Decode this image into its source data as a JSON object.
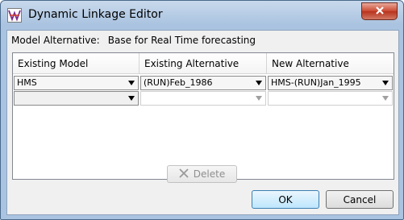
{
  "window": {
    "title": "Dynamic Linkage Editor",
    "icon": "app-logo-icon",
    "close_icon": "close-icon"
  },
  "model_alternative": {
    "label": "Model Alternative:",
    "value": "Base for Real Time forecasting"
  },
  "table": {
    "columns": [
      "Existing Model",
      "Existing Alternative",
      "New Alternative"
    ],
    "rows": [
      {
        "existing_model": "HMS",
        "existing_alternative": "(RUN)Feb_1986",
        "new_alternative": "HMS-(RUN)Jan_1995"
      },
      {
        "existing_model": "",
        "existing_alternative": "",
        "new_alternative": ""
      }
    ]
  },
  "buttons": {
    "delete": "Delete",
    "ok": "OK",
    "cancel": "Cancel"
  },
  "colors": {
    "accent_close": "#c9472f",
    "default_button": "#bee6fd"
  }
}
